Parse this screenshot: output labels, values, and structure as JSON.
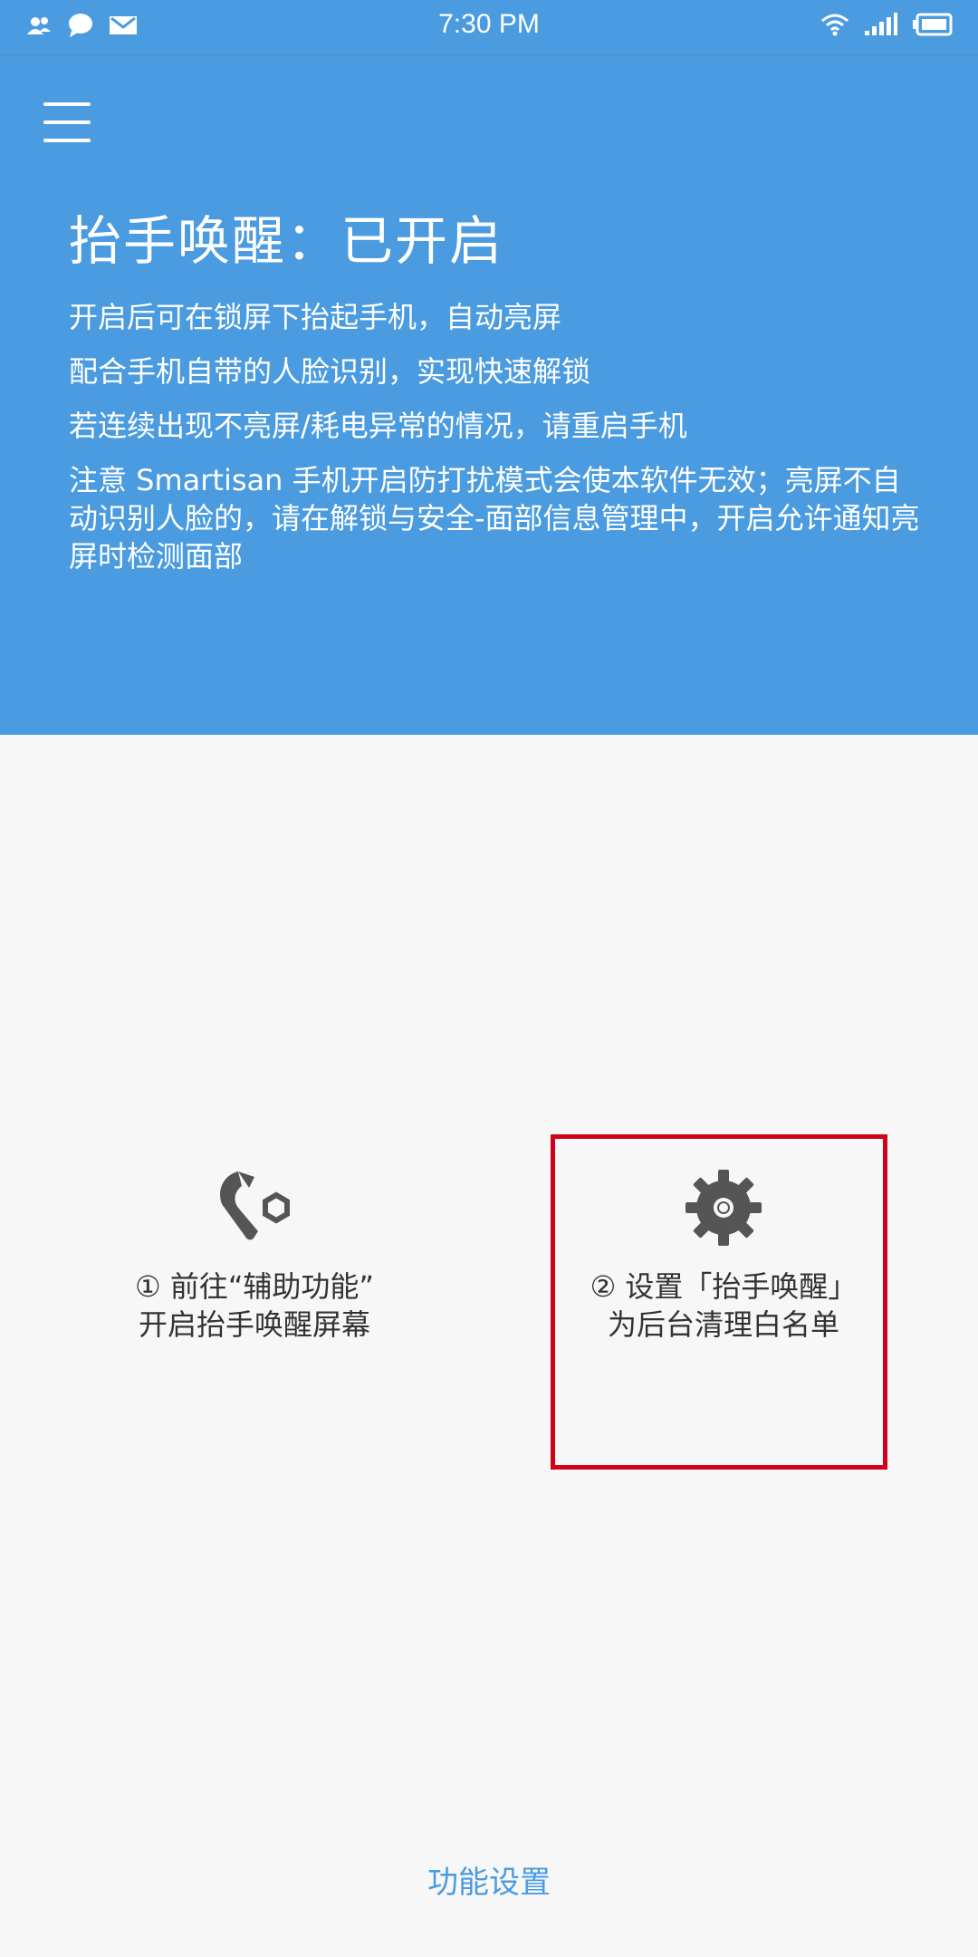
{
  "status_bar": {
    "time": "7:30 PM",
    "left_icons": [
      "contacts-icon",
      "chat-bubble-icon",
      "mail-icon"
    ],
    "right_icons": [
      "wifi-icon",
      "signal-icon",
      "battery-icon"
    ]
  },
  "header": {
    "title": "抬手唤醒：已开启",
    "lines": [
      "开启后可在锁屏下抬起手机，自动亮屏",
      "配合手机自带的人脸识别，实现快速解锁",
      "若连续出现不亮屏/耗电异常的情况，请重启手机",
      "注意 Smartisan 手机开启防打扰模式会使本软件无效；亮屏不自动识别人脸的，请在解锁与安全-面部信息管理中，开启允许通知亮屏时检测面部"
    ]
  },
  "options": [
    {
      "icon": "wrench-hexnut-icon",
      "line1": "① 前往“辅助功能”",
      "line2": "开启抬手唤醒屏幕"
    },
    {
      "icon": "gear-icon",
      "line1": "② 设置「抬手唤醒」",
      "line2": "为后台清理白名单"
    }
  ],
  "footer": {
    "link_label": "功能设置"
  },
  "colors": {
    "primary": "#4a9be0",
    "background": "#f7f7f7",
    "highlight": "#d0021b",
    "icon_gray": "#555555"
  }
}
